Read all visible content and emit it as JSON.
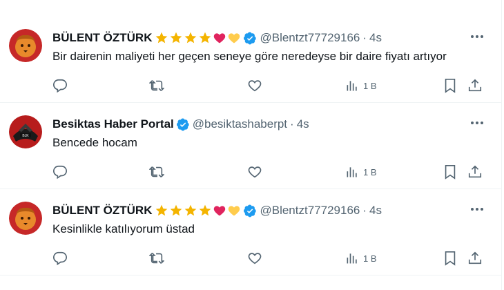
{
  "tweets": [
    {
      "name": "BÜLENT ÖZTÜRK",
      "handle": "@Blentzt77729166",
      "dot": "·",
      "time": "4s",
      "text": "Bir dairenin maliyeti her geçen seneye göre neredeyse bir daire fiyatı artıyor",
      "views": "1 B",
      "avatar": "lion-avatar",
      "badges": [
        "star",
        "star",
        "star",
        "star",
        "red-heart",
        "yellow-heart"
      ]
    },
    {
      "name": "Besiktas Haber Portal",
      "handle": "@besiktashaberpt",
      "dot": "·",
      "time": "4s",
      "text": "Bencede hocam",
      "views": "1 B",
      "avatar": "eagle-logo-avatar"
    },
    {
      "name": "BÜLENT ÖZTÜRK",
      "handle": "@Blentzt77729166",
      "dot": "·",
      "time": "4s",
      "text": "Kesinlikle katılıyorum üstad",
      "views": "1 B",
      "avatar": "lion-avatar",
      "badges": [
        "star",
        "star",
        "star",
        "star",
        "red-heart",
        "yellow-heart"
      ]
    }
  ],
  "colors": {
    "verified": "#1d9bf0",
    "star": "#f4b400",
    "red_heart": "#e0245e",
    "yellow_heart": "#ffcc4d",
    "secondary_text": "#536471"
  }
}
